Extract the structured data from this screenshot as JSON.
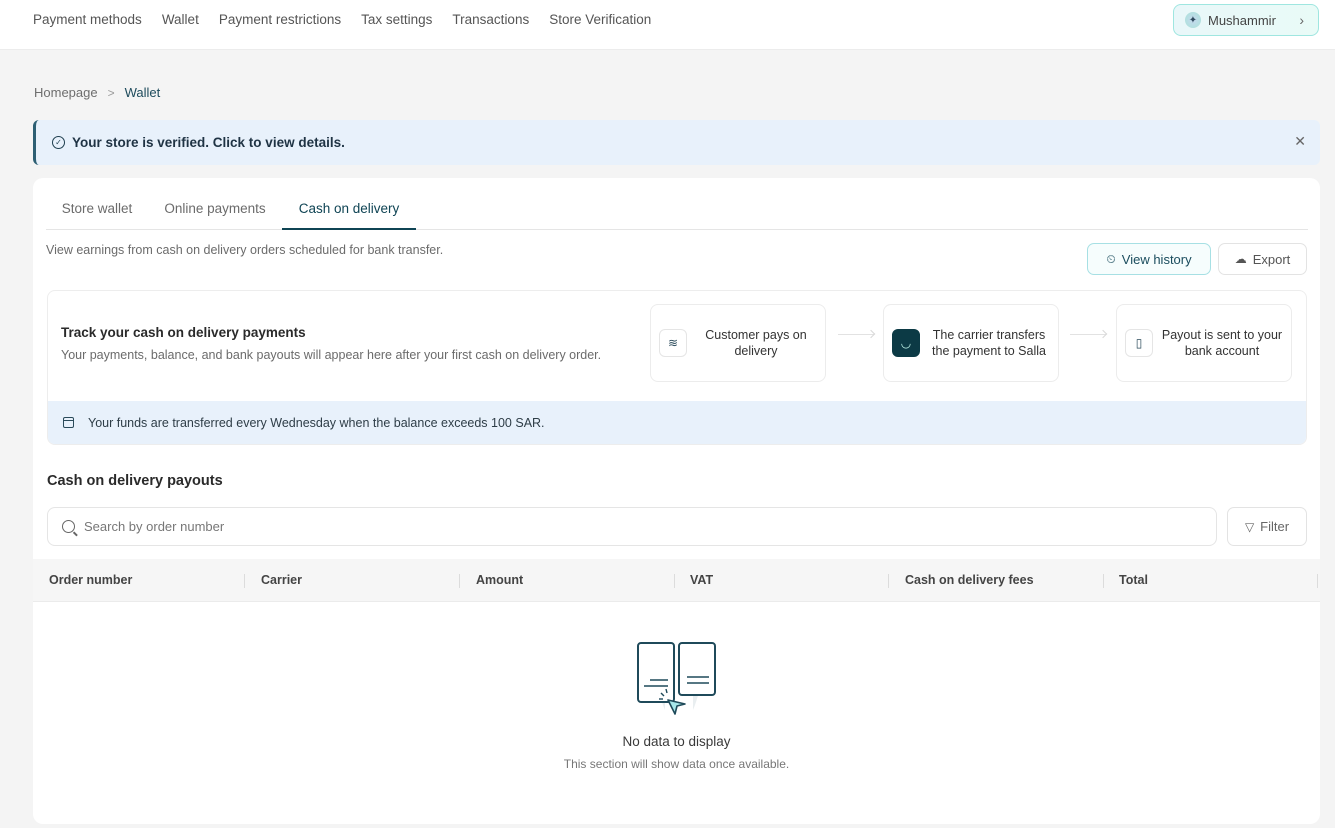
{
  "topnav": {
    "items": [
      "Payment methods",
      "Wallet",
      "Payment restrictions",
      "Tax settings",
      "Transactions",
      "Store Verification"
    ],
    "user": {
      "name": "Mushammir",
      "icon": "sparkle-icon"
    }
  },
  "breadcrumb": {
    "home": "Homepage",
    "current": "Wallet"
  },
  "banner": {
    "text": "Your store is verified. Click to view details.",
    "icon": "check-circle-icon"
  },
  "tabs": [
    "Store wallet",
    "Online payments",
    "Cash on delivery"
  ],
  "active_tab": "Cash on delivery",
  "description": "View earnings from cash on delivery orders scheduled for bank transfer.",
  "actions": {
    "history_label": "View history",
    "export_label": "Export"
  },
  "track": {
    "title": "Track your cash on delivery payments",
    "subtitle": "Your payments, balance, and bank payouts will appear here after your first cash on delivery order.",
    "steps": [
      {
        "text": "Customer pays on delivery",
        "icon": "cash-icon"
      },
      {
        "text": "The carrier transfers the payment to Salla",
        "icon": "salla-logo-icon"
      },
      {
        "text": "Payout is sent to your bank account",
        "icon": "bank-icon"
      }
    ],
    "info": "Your funds are transferred every Wednesday when the balance exceeds 100 SAR."
  },
  "payouts": {
    "title": "Cash on delivery payouts",
    "search_placeholder": "Search by order number",
    "filter_label": "Filter",
    "columns": [
      "Order number",
      "Carrier",
      "Amount",
      "VAT",
      "Cash on delivery fees",
      "Total"
    ],
    "rows": []
  },
  "empty": {
    "title": "No data to display",
    "subtitle": "This section will show data once available."
  }
}
